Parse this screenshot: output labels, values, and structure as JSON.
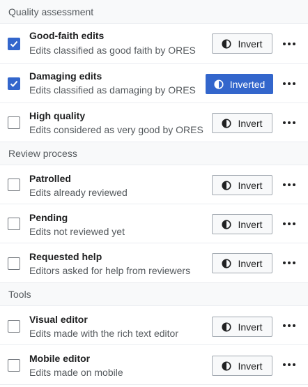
{
  "groups": [
    {
      "header": "Quality assessment",
      "items": [
        {
          "title": "Good-faith edits",
          "description": "Edits classified as good faith by ORES",
          "checked": true,
          "button_label": "Invert",
          "inverted": false
        },
        {
          "title": "Damaging edits",
          "description": "Edits classified as damaging by ORES",
          "checked": true,
          "button_label": "Inverted",
          "inverted": true
        },
        {
          "title": "High quality",
          "description": "Edits considered as very good by ORES",
          "checked": false,
          "button_label": "Invert",
          "inverted": false
        }
      ]
    },
    {
      "header": "Review process",
      "items": [
        {
          "title": "Patrolled",
          "description": "Edits already reviewed",
          "checked": false,
          "button_label": "Invert",
          "inverted": false
        },
        {
          "title": "Pending",
          "description": "Edits not reviewed yet",
          "checked": false,
          "button_label": "Invert",
          "inverted": false
        },
        {
          "title": "Requested help",
          "description": "Editors asked for help from reviewers",
          "checked": false,
          "button_label": "Invert",
          "inverted": false
        }
      ]
    },
    {
      "header": "Tools",
      "items": [
        {
          "title": "Visual editor",
          "description": "Edits made with the rich text editor",
          "checked": false,
          "button_label": "Invert",
          "inverted": false
        },
        {
          "title": "Mobile editor",
          "description": "Edits made on mobile",
          "checked": false,
          "button_label": "Invert",
          "inverted": false
        }
      ]
    }
  ],
  "icons": {
    "checkbox_check": "checkmark-icon",
    "invert_button": "contrast-icon",
    "row_menu": "ellipsis-icon"
  },
  "colors": {
    "accent": "#3366cc",
    "text": "#202122",
    "subtle_text": "#54595d",
    "border": "#eaecf0",
    "header_bg": "#f8f9fa"
  }
}
